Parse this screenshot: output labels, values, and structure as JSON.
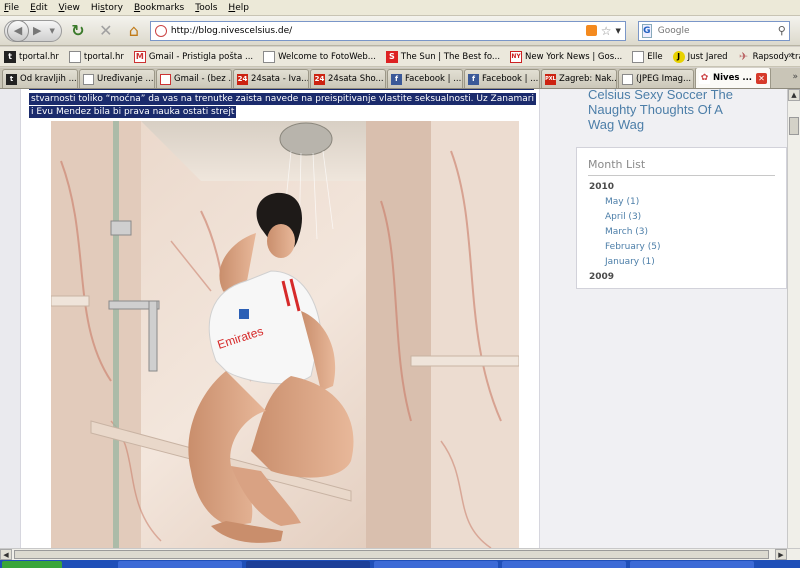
{
  "menu": [
    "File",
    "Edit",
    "View",
    "History",
    "Bookmarks",
    "Tools",
    "Help"
  ],
  "menu_access": [
    "F",
    "E",
    "V",
    "s",
    "B",
    "T",
    "H"
  ],
  "url": "http://blog.nivescelsius.de/",
  "search": {
    "placeholder": "Google",
    "engine_letter": "G"
  },
  "icons": {
    "back": "back-arrow-icon",
    "forward": "forward-arrow-icon",
    "reload": "reload-icon",
    "stop": "stop-icon",
    "home": "home-icon",
    "feed": "rss-icon",
    "bookmark_star": "star-icon",
    "search": "magnifier-icon"
  },
  "bookmarks": [
    {
      "label": "tportal.hr",
      "icon": "t"
    },
    {
      "label": "tportal.hr",
      "icon": ""
    },
    {
      "label": "Gmail - Pristigla pošta ...",
      "icon": "M"
    },
    {
      "label": "Welcome to FotoWeb...",
      "icon": ""
    },
    {
      "label": "The Sun | The Best fo...",
      "icon": "S"
    },
    {
      "label": "New York News | Gos...",
      "icon": "NY"
    },
    {
      "label": "Elle",
      "icon": ""
    },
    {
      "label": "Just Jared",
      "icon": "J"
    },
    {
      "label": "Rapsody travel - turis...",
      "icon": "✈"
    }
  ],
  "bookmarks_overflow": "»",
  "tabs": [
    {
      "label": "Od kravljih ...",
      "icon": "t",
      "active": false
    },
    {
      "label": "Uređivanje ...",
      "icon": "",
      "active": false
    },
    {
      "label": "Gmail - (bez ...",
      "icon": "M",
      "active": false
    },
    {
      "label": "24sata - Iva...",
      "icon": "24",
      "active": false
    },
    {
      "label": "24sata Sho...",
      "icon": "24",
      "active": false
    },
    {
      "label": "Facebook | ...",
      "icon": "f",
      "active": false
    },
    {
      "label": "Facebook | ...",
      "icon": "f",
      "active": false
    },
    {
      "label": "Zagreb: Nak...",
      "icon": "PXL",
      "active": false
    },
    {
      "label": "(JPEG Imag...",
      "icon": "",
      "active": false
    },
    {
      "label": "Nives ...",
      "icon": "✿",
      "active": true
    }
  ],
  "tab_close": "✕",
  "post": {
    "lines": [
      "stvarnosti toliko “moćna” da vas na trenutke zaista navede na preispitivanje vlastite seksualnosti. Uz Zanamari",
      "i Evu Mendez bila bi prava nauka ostati strejt"
    ]
  },
  "sidebar": {
    "recent_post_fragment": [
      "Celsius Sexy Soccer The",
      "Naughty Thoughts Of A",
      "Wag Wag"
    ],
    "month_list": {
      "title": "Month List",
      "years": [
        {
          "year": "2010",
          "months": [
            "May (1)",
            "April (3)",
            "March (3)",
            "February (5)",
            "January (1)"
          ]
        },
        {
          "year": "2009",
          "months": []
        }
      ]
    }
  },
  "colors": {
    "selection": "#1b2b6c",
    "link": "#4c7ea8",
    "active_tab": "#fbfaf6",
    "tab_close": "#d63a2a"
  }
}
